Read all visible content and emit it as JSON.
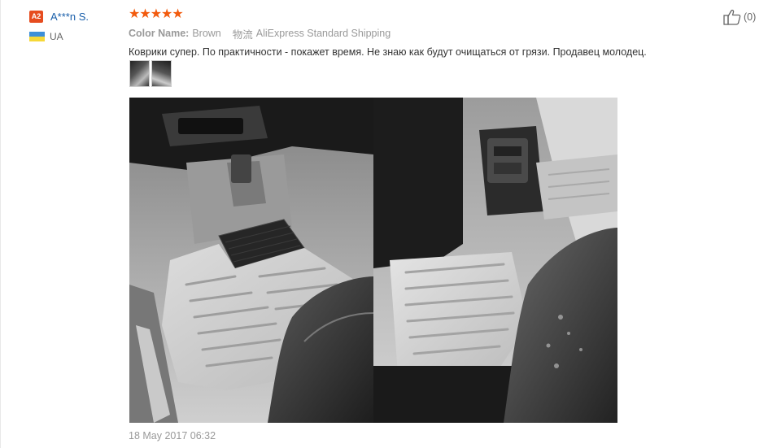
{
  "reviewer": {
    "level_badge": "A2",
    "name": "A***n S.",
    "country": "UA"
  },
  "review": {
    "rating": 5,
    "color_label": "Color Name:",
    "color_value": "Brown",
    "shipping_label": "物流",
    "shipping_value": "AliExpress Standard Shipping",
    "text": "Коврики супер. По практичности - покажет время. Не знаю как будут очищаться от грязи. Продавец молодец.",
    "date": "18 May 2017 06:32"
  },
  "helpful": {
    "count": "(0)"
  },
  "icons": {
    "like": "thumbs-up-icon",
    "star": "star-icon",
    "flag": "ukraine-flag-icon"
  },
  "colors": {
    "accent_star": "#f25b0e",
    "badge": "#e64c1f",
    "link": "#1a5faa"
  }
}
